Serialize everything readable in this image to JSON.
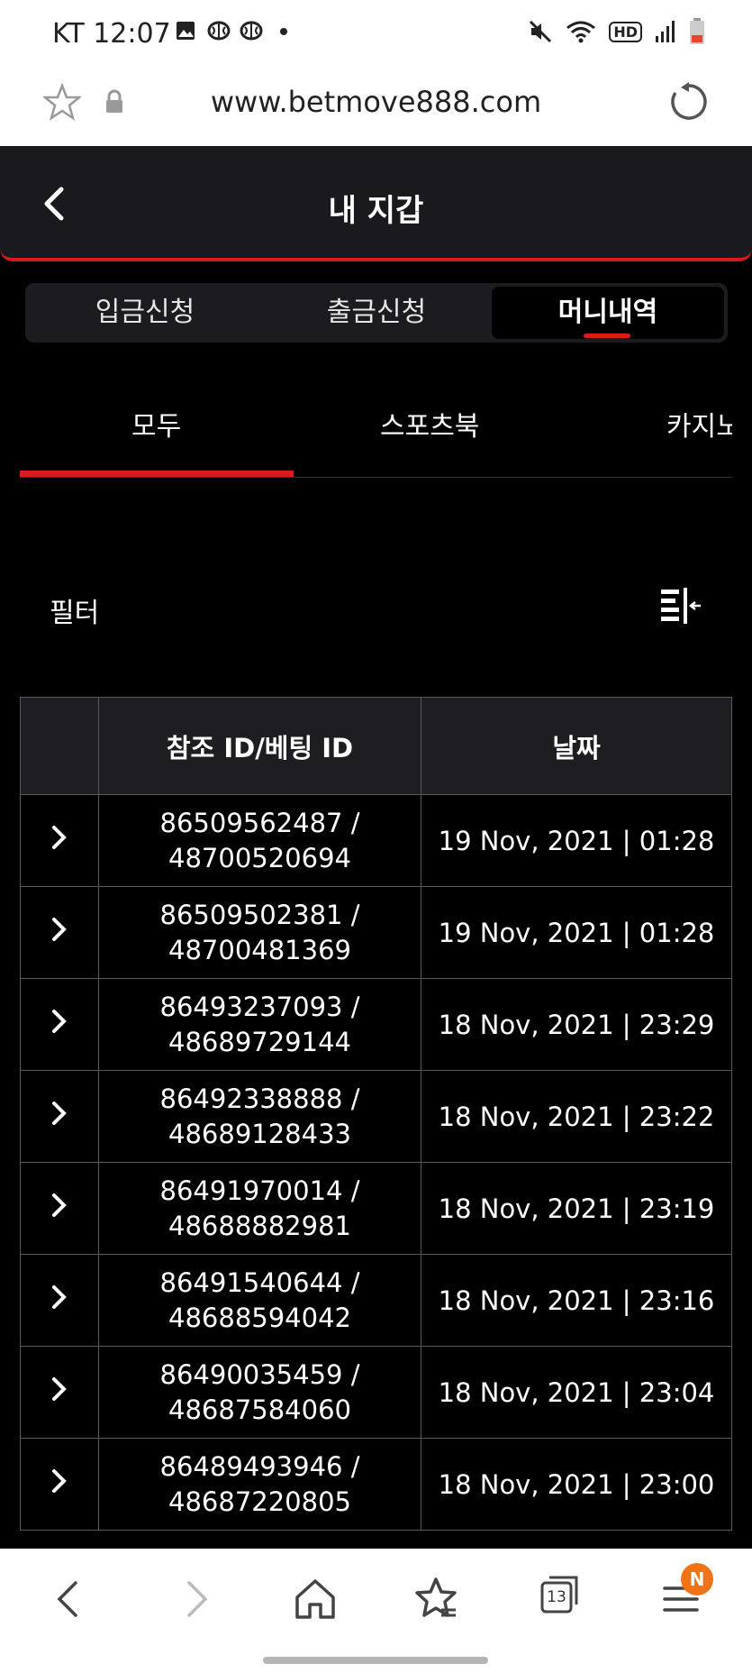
{
  "status_bar": {
    "carrier_time": "KT 12:07",
    "hd_label": "HD"
  },
  "browser": {
    "url": "www.betmove888.com",
    "tab_count": "13",
    "menu_badge": "N"
  },
  "header": {
    "title": "내 지갑"
  },
  "segments": [
    {
      "label": "입금신청"
    },
    {
      "label": "출금신청"
    },
    {
      "label": "머니내역"
    }
  ],
  "subtabs": [
    {
      "label": "모두"
    },
    {
      "label": "스포츠북"
    },
    {
      "label": "카지노"
    }
  ],
  "filter": {
    "label": "필터"
  },
  "table": {
    "columns": [
      "",
      "참조 ID/베팅 ID",
      "날짜"
    ],
    "rows": [
      {
        "ref_id": "86509562487 /",
        "bet_id": "48700520694",
        "date": "19 Nov, 2021 | 01:28"
      },
      {
        "ref_id": "86509502381 /",
        "bet_id": "48700481369",
        "date": "19 Nov, 2021 | 01:28"
      },
      {
        "ref_id": "86493237093 /",
        "bet_id": "48689729144",
        "date": "18 Nov, 2021 | 23:29"
      },
      {
        "ref_id": "86492338888 /",
        "bet_id": "48689128433",
        "date": "18 Nov, 2021 | 23:22"
      },
      {
        "ref_id": "86491970014 /",
        "bet_id": "48688882981",
        "date": "18 Nov, 2021 | 23:19"
      },
      {
        "ref_id": "86491540644 /",
        "bet_id": "48688594042",
        "date": "18 Nov, 2021 | 23:16"
      },
      {
        "ref_id": "86490035459 /",
        "bet_id": "48687584060",
        "date": "18 Nov, 2021 | 23:04"
      },
      {
        "ref_id": "86489493946 /",
        "bet_id": "48687220805",
        "date": "18 Nov, 2021 | 23:00"
      }
    ]
  },
  "colors": {
    "accent": "#d81a1a",
    "header_bg": "#1a1a1e",
    "badge": "#f07318"
  },
  "icons": [
    "gallery-icon",
    "brain-icon",
    "mute-icon",
    "wifi-icon",
    "signal-icon",
    "battery-icon",
    "star-icon",
    "lock-icon",
    "reload-icon",
    "back-arrow-icon",
    "filter-icon",
    "chevron-right-icon",
    "home-icon",
    "bookmark-icon",
    "tabs-icon",
    "menu-icon"
  ]
}
